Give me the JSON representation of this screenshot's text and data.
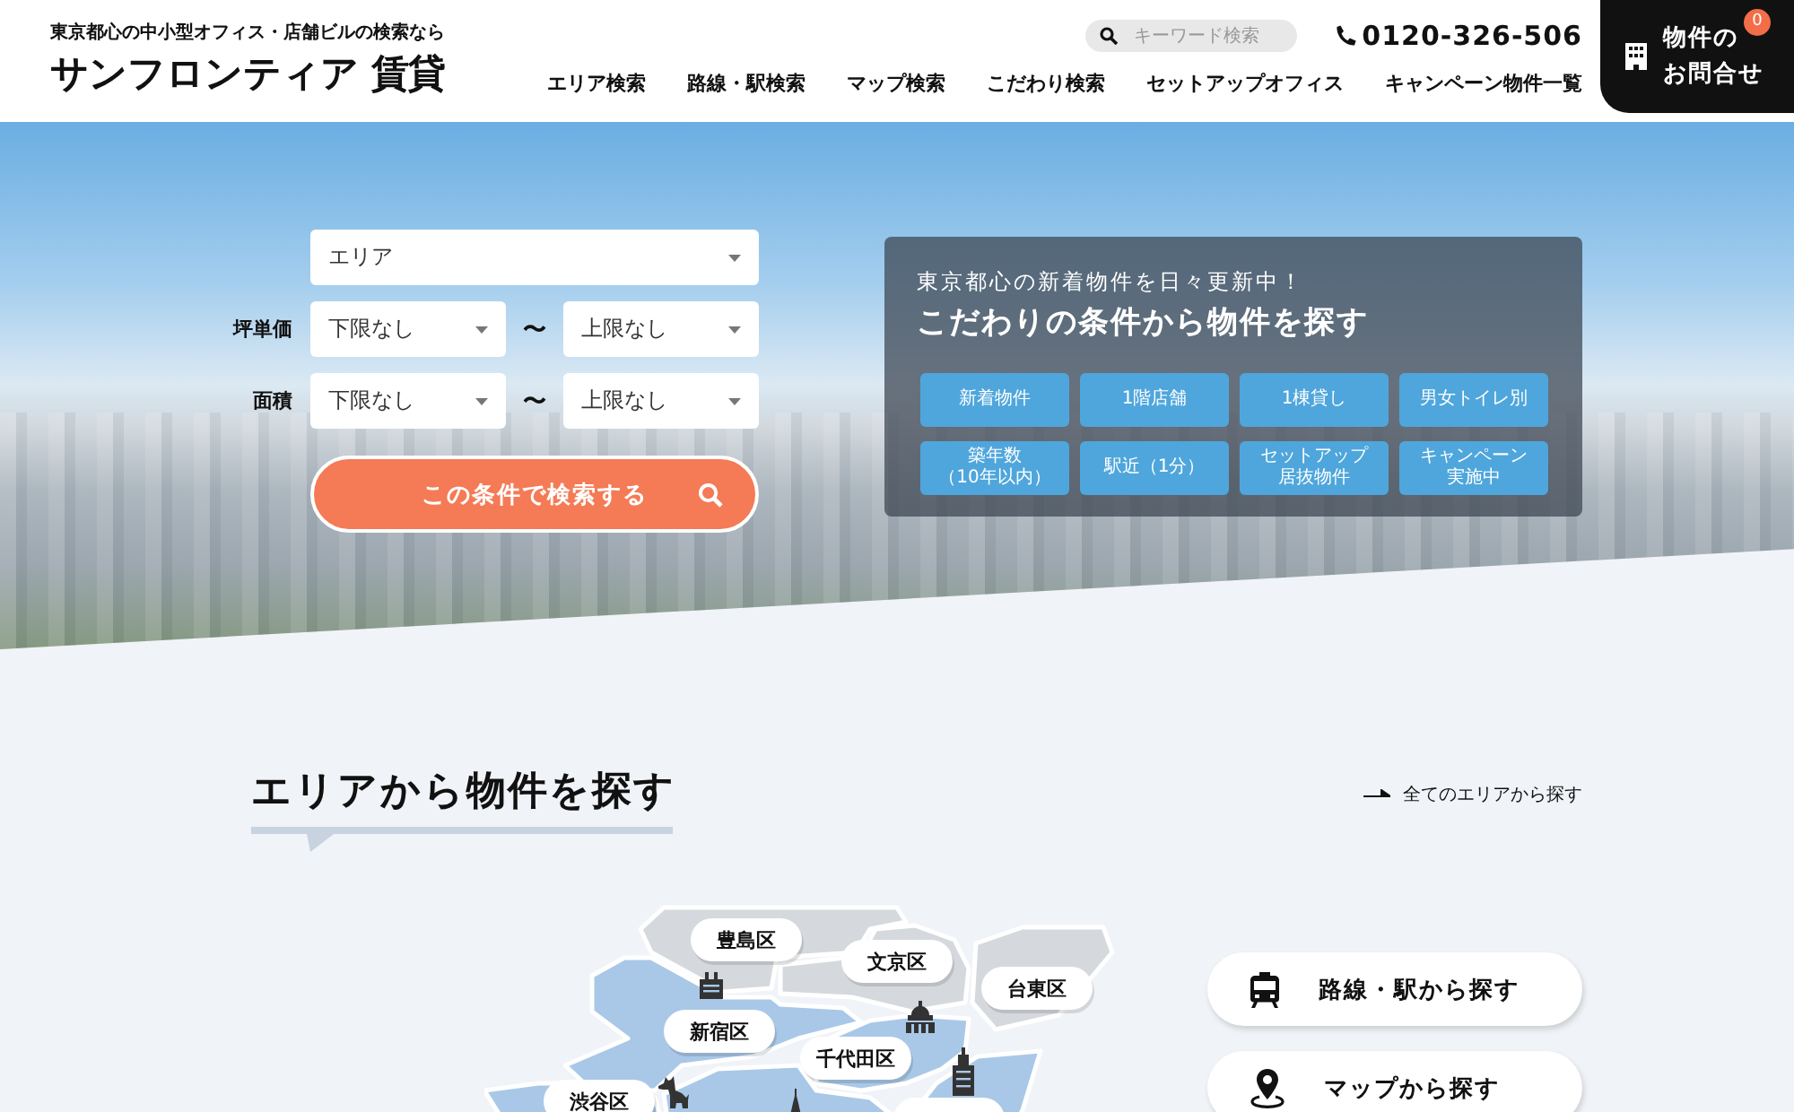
{
  "header": {
    "tagline": "東京都心の中小型オフィス・店舗ビルの検索なら",
    "logo": "サンフロンティア 賃貸",
    "search": {
      "placeholder": "キーワード検索"
    },
    "phone": "0120-326-506",
    "nav": [
      "エリア検索",
      "路線・駅検索",
      "マップ検索",
      "こだわり検索",
      "セットアップオフィス",
      "キャンペーン物件一覧"
    ],
    "contact": {
      "lines": [
        "物件の",
        "お問合せ"
      ],
      "badge": "0"
    }
  },
  "hero": {
    "search_form": {
      "area_select": "エリア",
      "rows": [
        {
          "label": "坪単価",
          "min": "下限なし",
          "separator": "〜",
          "max": "上限なし"
        },
        {
          "label": "面積",
          "min": "下限なし",
          "separator": "〜",
          "max": "上限なし"
        }
      ],
      "submit": "この条件で検索する"
    },
    "feature_panel": {
      "subtitle": "東京都心の新着物件を日々更新中！",
      "title": "こだわりの条件から物件を探す",
      "buttons": [
        {
          "lines": [
            "新着物件"
          ]
        },
        {
          "lines": [
            "1階店舗"
          ]
        },
        {
          "lines": [
            "1棟貸し"
          ]
        },
        {
          "lines": [
            "男女トイレ別"
          ]
        },
        {
          "lines": [
            "築年数",
            "（10年以内）"
          ]
        },
        {
          "lines": [
            "駅近（1分）"
          ]
        },
        {
          "lines": [
            "セットアップ",
            "居抜物件"
          ]
        },
        {
          "lines": [
            "キャンペーン",
            "実施中"
          ]
        }
      ]
    }
  },
  "area_section": {
    "title": "エリアから物件を探す",
    "all_areas_link": "全てのエリアから探す",
    "map_labels": [
      "豊島区",
      "文京区",
      "台東区",
      "新宿区",
      "千代田区",
      "渋谷区"
    ],
    "search_buttons": [
      {
        "kind": "train",
        "label": "路線・駅から探す"
      },
      {
        "kind": "pin",
        "label": "マップから探す"
      }
    ]
  }
}
